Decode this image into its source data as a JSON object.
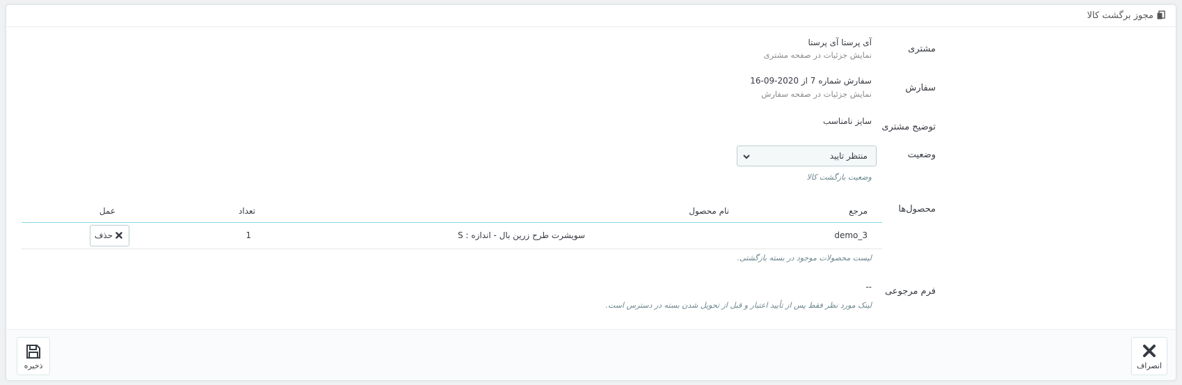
{
  "panel": {
    "title": "مجوز برگشت کالا",
    "icon": "copy-icon"
  },
  "fields": {
    "customer": {
      "label": "مشتری",
      "name": "آی پرستا آی پرستا",
      "link": "نمایش جزئیات در صفحه مشتری"
    },
    "order": {
      "label": "سفارش",
      "value": "سفارش شماره 7 از 2020-09-16",
      "link": "نمایش جزئیات در صفحه سفارش"
    },
    "customer_note": {
      "label": "توضیح مشتری",
      "value": "سایز نامناسب"
    },
    "status": {
      "label": "وضعیت",
      "selected": "منتظر تایید",
      "help": "وضعیت بازگشت کالا"
    },
    "products": {
      "label": "محصول‌ها",
      "columns": {
        "reference": "مرجع",
        "name": "نام محصول",
        "quantity": "تعداد",
        "action": "عمل"
      },
      "rows": [
        {
          "reference": "demo_3",
          "name": "سویشرت طرح زرین بال - اندازه : S",
          "quantity": "1",
          "action_label": "حذف"
        }
      ],
      "help": "لیست محصولات موجود در بسته بازگشتی."
    },
    "return_form": {
      "label": "فرم مرجوعی",
      "value": "--",
      "help": "لینک مورد نظر فقط پس از تأیید اعتبار و قبل از تحویل شدن بسته در دسترس است."
    }
  },
  "footer": {
    "cancel_label": "انصراف",
    "save_label": "ذخیره"
  },
  "colors": {
    "accent": "#25b9d7",
    "text": "#363a41",
    "muted": "#8a8a8a"
  }
}
